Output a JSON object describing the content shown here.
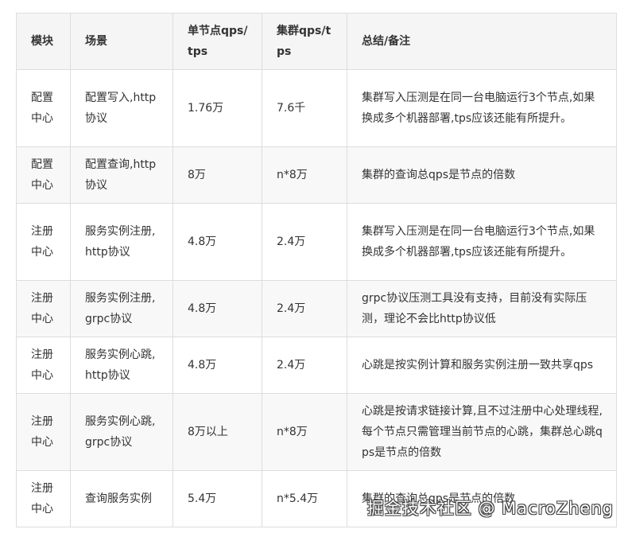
{
  "table": {
    "headers": [
      "模块",
      "场景",
      "单节点qps/tps",
      "集群qps/tps",
      "总结/备注"
    ],
    "rows": [
      [
        "配置中心",
        "配置写入,http协议",
        "1.76万",
        "7.6千",
        "集群写入压测是在同一台电脑运行3个节点,如果换成多个机器部署,tps应该还能有所提升。"
      ],
      [
        "配置中心",
        "配置查询,http协议",
        "8万",
        "n*8万",
        "集群的查询总qps是节点的倍数"
      ],
      [
        "注册中心",
        "服务实例注册,http协议",
        "4.8万",
        "2.4万",
        "集群写入压测是在同一台电脑运行3个节点,如果换成多个机器部署,tps应该还能有所提升。"
      ],
      [
        "注册中心",
        "服务实例注册,grpc协议",
        "4.8万",
        "2.4万",
        "grpc协议压测工具没有支持，目前没有实际压测，理论不会比http协议低"
      ],
      [
        "注册中心",
        "服务实例心跳,http协议",
        "4.8万",
        "2.4万",
        "心跳是按实例计算和服务实例注册一致共享qps"
      ],
      [
        "注册中心",
        "服务实例心跳,grpc协议",
        "8万以上",
        "n*8万",
        "心跳是按请求链接计算,且不过注册中心处理线程,每个节点只需管理当前节点的心跳，集群总心跳qps是节点的倍数"
      ],
      [
        "注册中心",
        "查询服务实例",
        "5.4万",
        "n*5.4万",
        "集群的查询总qps是节点的倍数"
      ]
    ]
  },
  "watermark": {
    "text": "掘金技术社区 @ MacroZheng"
  }
}
